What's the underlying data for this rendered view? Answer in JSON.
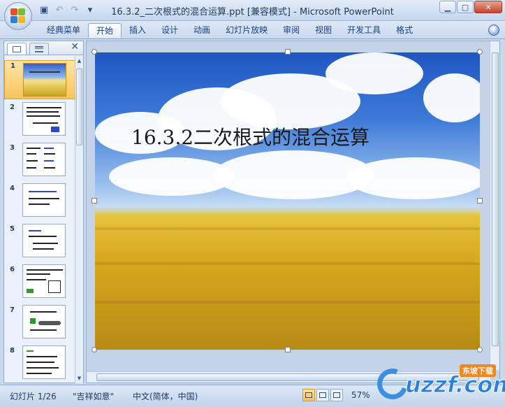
{
  "window": {
    "title": "16.3.2_二次根式的混合运算.ppt [兼容模式] - Microsoft PowerPoint"
  },
  "quick_access": {
    "icons": [
      "save-icon",
      "undo-icon",
      "redo-icon",
      "customize-dropdown-icon"
    ]
  },
  "ribbon": {
    "tabs": [
      {
        "label": "经典菜单",
        "active": false
      },
      {
        "label": "开始",
        "active": true
      },
      {
        "label": "插入",
        "active": false
      },
      {
        "label": "设计",
        "active": false
      },
      {
        "label": "动画",
        "active": false
      },
      {
        "label": "幻灯片放映",
        "active": false
      },
      {
        "label": "审阅",
        "active": false
      },
      {
        "label": "视图",
        "active": false
      },
      {
        "label": "开发工具",
        "active": false
      },
      {
        "label": "格式",
        "active": false
      }
    ],
    "help_label": "?"
  },
  "slides_panel": {
    "close_label": "✕",
    "thumbnails": [
      {
        "number": "1",
        "selected": true
      },
      {
        "number": "2",
        "selected": false
      },
      {
        "number": "3",
        "selected": false
      },
      {
        "number": "4",
        "selected": false
      },
      {
        "number": "5",
        "selected": false
      },
      {
        "number": "6",
        "selected": false
      },
      {
        "number": "7",
        "selected": false
      },
      {
        "number": "8",
        "selected": false
      }
    ]
  },
  "slide": {
    "title": "16.3.2二次根式的混合运算"
  },
  "statusbar": {
    "slide_info": "幻灯片 1/26",
    "theme": "\"吉祥如意\"",
    "language": "中文(简体，中国)",
    "zoom": "57%"
  },
  "watermark": {
    "text": "uzzf.com",
    "badge": "东坡下载"
  },
  "colors": {
    "accent": "#15428b",
    "selection": "#f9c45d"
  }
}
